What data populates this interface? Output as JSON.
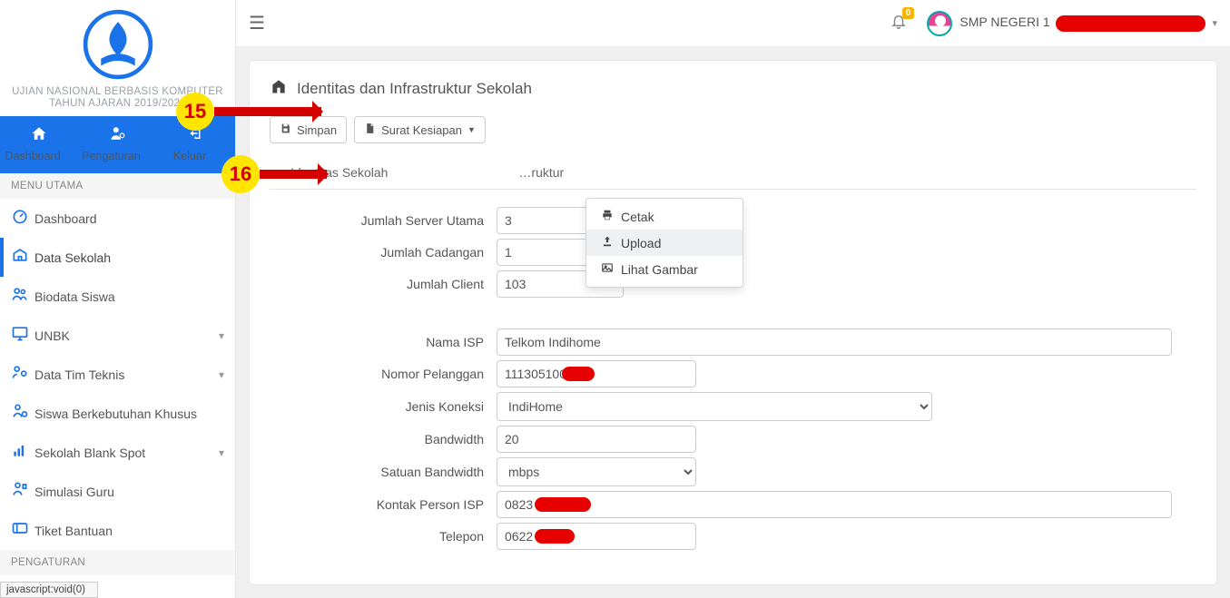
{
  "brand": {
    "line1": "UJIAN NASIONAL BERBASIS KOMPUTER",
    "line2": "TAHUN AJARAN 2019/2020"
  },
  "topnav": {
    "dashboard": "Dashboard",
    "pengaturan": "Pengaturan",
    "keluar": "Keluar"
  },
  "menu": {
    "head1": "MENU UTAMA",
    "head2": "PENGATURAN",
    "items": {
      "dashboard": "Dashboard",
      "data_sekolah": "Data Sekolah",
      "biodata": "Biodata Siswa",
      "unbk": "UNBK",
      "tim_teknis": "Data Tim Teknis",
      "siswa_khusus": "Siswa Berkebutuhan Khusus",
      "blank_spot": "Sekolah Blank Spot",
      "simulasi": "Simulasi Guru",
      "tiket": "Tiket Bantuan"
    }
  },
  "topbar": {
    "bell_badge": "0",
    "user_prefix": "SMP NEGERI 1"
  },
  "card": {
    "title": "Identitas dan Infrastruktur Sekolah",
    "btn_simpan": "Simpan",
    "btn_surat": "Surat Kesiapan",
    "tabs": {
      "identitas": "Identitas Sekolah",
      "infra": "Infrastruktur"
    }
  },
  "dropdown": {
    "cetak": "Cetak",
    "upload": "Upload",
    "lihat": "Lihat Gambar"
  },
  "callouts": {
    "c15": "15",
    "c16": "16"
  },
  "form": {
    "labels": {
      "server": "Jumlah Server Utama",
      "cadangan": "Jumlah Cadangan",
      "client": "Jumlah Client",
      "isp": "Nama ISP",
      "pelanggan": "Nomor Pelanggan",
      "koneksi": "Jenis Koneksi",
      "bandwidth": "Bandwidth",
      "satuan": "Satuan Bandwidth",
      "kontak": "Kontak Person ISP",
      "telepon": "Telepon"
    },
    "values": {
      "server": "3",
      "cadangan": "1",
      "client": "103",
      "isp": "Telkom Indihome",
      "pelanggan": "111305100",
      "koneksi": "IndiHome",
      "bandwidth": "20",
      "satuan": "mbps",
      "kontak": "0823",
      "telepon": "0622"
    }
  },
  "status": "javascript:void(0)"
}
